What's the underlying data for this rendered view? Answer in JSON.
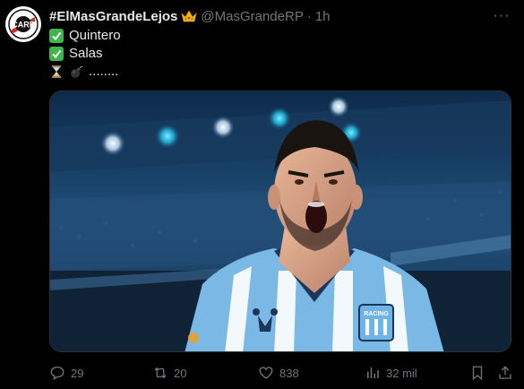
{
  "tweet": {
    "display_name": "#ElMasGrandeLejos",
    "handle": "@MasGrandeRP",
    "separator": "·",
    "time": "1h",
    "more_label": "···",
    "lines": [
      {
        "icon": "check-mark-icon",
        "text": "Quintero"
      },
      {
        "icon": "check-mark-icon",
        "text": "Salas"
      },
      {
        "icon": "hourglass-bomb-icons",
        "text": "........"
      }
    ]
  },
  "actions": {
    "replies": "29",
    "reposts": "20",
    "likes": "838",
    "views": "32 mil"
  },
  "media": {
    "jersey_badge": "RACING",
    "jersey_brand": "Kappa"
  },
  "colors": {
    "background": "#000000",
    "text": "#e7e9ea",
    "muted": "#71767b",
    "check_green": "#3fb64b",
    "club_red": "#d52b2b"
  }
}
